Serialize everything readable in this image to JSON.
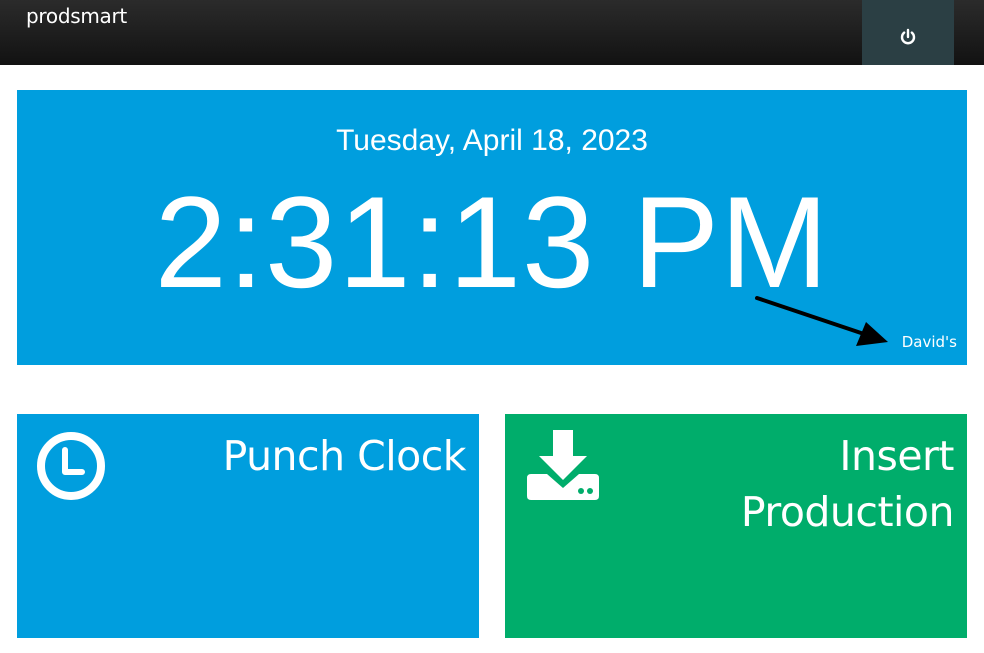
{
  "header": {
    "brand": "prodsmart",
    "power_icon": "power-icon"
  },
  "clock": {
    "date": "Tuesday, April 18, 2023",
    "time": "2:31:13 PM",
    "owner_label": "David's",
    "annotation_icon": "arrow-icon"
  },
  "tiles": [
    {
      "title": "Punch Clock",
      "icon": "clock-icon",
      "color": "#009ede"
    },
    {
      "title_line1": "Insert",
      "title_line2": "Production",
      "icon": "download-tray-icon",
      "color": "#00ad6b"
    }
  ],
  "colors": {
    "header_bg": "#1a1a1a",
    "power_bg": "#2b3f44",
    "blue": "#009ede",
    "green": "#00ad6b"
  }
}
